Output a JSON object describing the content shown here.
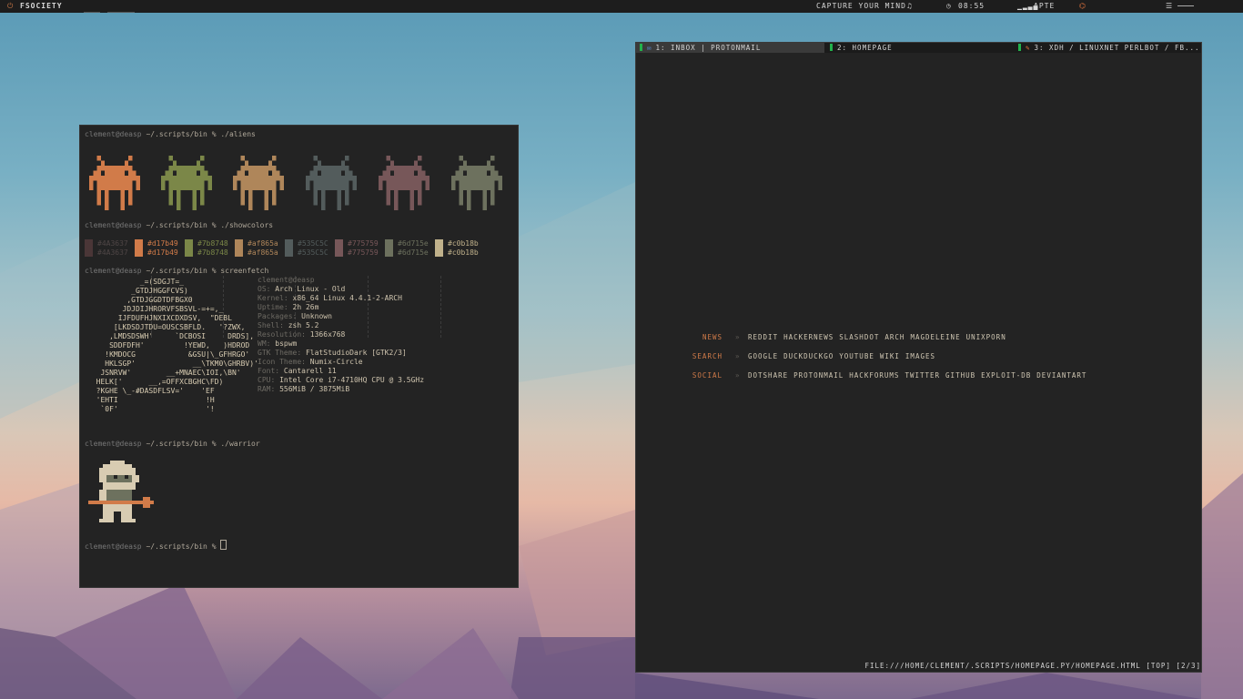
{
  "topbar": {
    "left_label": "FSOCIETY",
    "music": "CAPTURE YOUR MIND",
    "time": "08:55",
    "network": "APTE"
  },
  "terminal": {
    "prompt_user": "clement",
    "prompt_host": "@deasp",
    "prompt_dir": " ~/.scripts/bin % ",
    "cmd_aliens": "./aliens",
    "cmd_showcolors": "./showcolors",
    "cmd_screenfetch": "screenfetch",
    "cmd_warrior": "./warrior",
    "colors": [
      {
        "hex": "#4A3637",
        "dim": "#4A3637",
        "bright": "#d17b49"
      },
      {
        "hex": "#d17b49",
        "dim": "#d17b49",
        "bright": "#d17b49"
      },
      {
        "hex": "#7b8748",
        "dim": "#7b8748",
        "bright": "#7b8748"
      },
      {
        "hex": "#af865a",
        "dim": "#af865a",
        "bright": "#af865a"
      },
      {
        "hex": "#535C5C",
        "dim": "#535C5C",
        "bright": "#535C5C"
      },
      {
        "hex": "#775759",
        "dim": "#775759",
        "bright": "#775759"
      },
      {
        "hex": "#6d715e",
        "dim": "#6d715e",
        "bright": "#6d715e"
      },
      {
        "hex": "#c0b18b",
        "dim": "#c0b18b",
        "bright": "#c0b18b"
      }
    ],
    "swatch_labels_top": [
      "#4A3637",
      "#d17b49",
      "#7b8748",
      "#af865a",
      "#535C5C",
      "#775759",
      "#6d715e",
      "#c0b18b"
    ],
    "swatch_labels_bottom": [
      "#4A3637",
      "#d17b49",
      "#7b8748",
      "#af865a",
      "#535C5C",
      "#775759",
      "#6d715e",
      "#c0b18b"
    ],
    "logo_lines": [
      "            _=(SDGJT=_",
      "          _GTDJHGGFCVS)",
      "         ,GTDJGGDTDFBGX0",
      "        JDJDIJHRORVFSBSVL-=+=,_",
      "       IJFDUFHJNXIXCDXDSV,  \"DEBL",
      "      [LKDSDJTDU=OUSCSBFLD.   '?ZWX,",
      "     ,LMDSDSWH'     `DCBOSI     DRDS],",
      "     SDDFDFH'         !YEWD,   )HDROD",
      "    !KMDOCG            &GSU|\\_GFHRGO'",
      "    HKLSGP'             __\\TKM0\\GHRBV)'",
      "   JSNRVW'        __+MNAEC\\IOI,\\BN'",
      "  HELK['      __,=OFFXCBGHC\\FD)",
      "  ?KGHE \\_-#DASDFLSV='    'EF",
      "  'EHTI                    !H",
      "   `0F'                    '!"
    ],
    "info_header": "clement@deasp",
    "info": [
      {
        "k": "OS: ",
        "v": "Arch Linux - Old"
      },
      {
        "k": "Kernel: ",
        "v": "x86_64 Linux 4.4.1-2-ARCH"
      },
      {
        "k": "Uptime: ",
        "v": "2h 26m"
      },
      {
        "k": "Packages: ",
        "v": "Unknown"
      },
      {
        "k": "Shell: ",
        "v": "zsh 5.2"
      },
      {
        "k": "Resolution: ",
        "v": "1366x768"
      },
      {
        "k": "WM: ",
        "v": "bspwm"
      },
      {
        "k": "GTK Theme: ",
        "v": "FlatStudioDark [GTK2/3]"
      },
      {
        "k": "Icon Theme: ",
        "v": "Numix-Circle"
      },
      {
        "k": "Font: ",
        "v": "Cantarell 11"
      },
      {
        "k": "CPU: ",
        "v": "Intel Core i7-4710HQ CPU @ 3.5GHz"
      },
      {
        "k": "RAM: ",
        "v": "556MiB / 3875MiB"
      }
    ],
    "alien_colors": [
      "#d17b49",
      "#7b8748",
      "#af865a",
      "#535C5C",
      "#775759",
      "#6d715e"
    ]
  },
  "browser": {
    "tabs": [
      {
        "label": "1: INBOX | PROTONMAIL",
        "active": true
      },
      {
        "label": "2: HOMEPAGE",
        "active": false
      },
      {
        "label": "3: XDH / LINUXNET PERLBOT / FB...",
        "active": false
      }
    ],
    "sections": [
      {
        "name": "NEWS",
        "links": [
          "REDDIT",
          "HACKERNEWS",
          "SLASHDOT",
          "ARCH",
          "MAGDELEINE",
          "UNIXPORN"
        ]
      },
      {
        "name": "SEARCH",
        "links": [
          "GOOGLE",
          "DUCKDUCKGO",
          "YOUTUBE",
          "WIKI",
          "IMAGES"
        ]
      },
      {
        "name": "SOCIAL",
        "links": [
          "DOTSHARE",
          "PROTONMAIL",
          "HACKFORUMS",
          "TWITTER",
          "GITHUB",
          "EXPLOIT-DB",
          "DEVIANTART"
        ]
      }
    ],
    "arrow": "»",
    "status": "FILE:///HOME/CLEMENT/.SCRIPTS/HOMEPAGE.PY/HOMEPAGE.HTML [TOP] [2/3]"
  }
}
